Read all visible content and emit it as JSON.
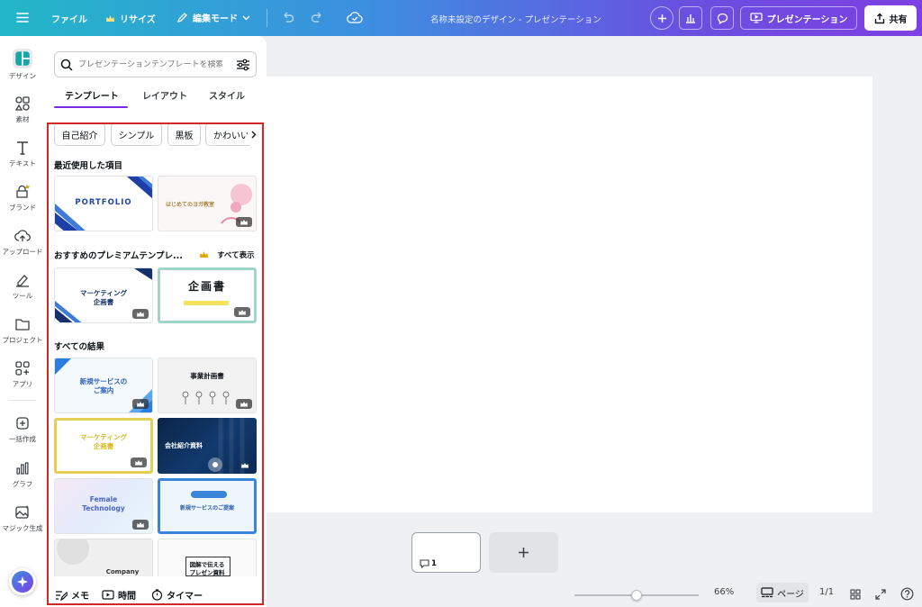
{
  "topbar": {
    "file": "ファイル",
    "resize": "リサイズ",
    "edit_mode": "編集モード",
    "doc_title": "名称未設定のデザイン - プレゼンテーション",
    "present": "プレゼンテーション",
    "share": "共有"
  },
  "sidebar": {
    "design": "デザイン",
    "elements": "素材",
    "text": "テキスト",
    "brand": "ブランド",
    "upload": "アップロード",
    "draw": "ツール",
    "projects": "プロジェクト",
    "apps": "アプリ",
    "bulk": "一括作成",
    "graph": "グラフ",
    "magic": "マジック生成"
  },
  "panel": {
    "search_placeholder": "プレゼンテーションテンプレートを検索",
    "tabs": {
      "templates": "テンプレート",
      "layout": "レイアウト",
      "style": "スタイル"
    },
    "chips": [
      "自己紹介",
      "シンプル",
      "黒板",
      "かわいい"
    ],
    "recent_title": "最近使用した項目",
    "premium_title": "おすすめのプレミアムテンプレ...",
    "see_all": "すべて表示",
    "all_title": "すべての結果",
    "thumbs": {
      "portfolio": "PORTFOLIO",
      "yoga": "はじめてのヨガ教室",
      "marketing1_line1": "マーケティング",
      "marketing1_line2": "企画書",
      "kikaku": "企画書",
      "shinki_line1": "新規サービスの",
      "shinki_line2": "ご案内",
      "jigyo": "事業計画書",
      "marketing2_line1": "マーケティング",
      "marketing2_line2": "企画書",
      "kaisha": "会社紹介資料",
      "female_line1": "Female",
      "female_line2": "Technology",
      "shinki2": "新規サービスのご提案",
      "company": "Company",
      "zukai_line1": "図解で伝える",
      "zukai_line2": "プレゼン資料"
    }
  },
  "bottom_tools": {
    "memo": "メモ",
    "time": "時間",
    "timer": "タイマー"
  },
  "status": {
    "zoom": "66%",
    "pages_label": "ページ",
    "page_count": "1/1",
    "page_number": "1",
    "zoom_level": 0.5
  },
  "colors": {
    "accent": "#7d2ae8",
    "highlight_box": "#d32626"
  }
}
